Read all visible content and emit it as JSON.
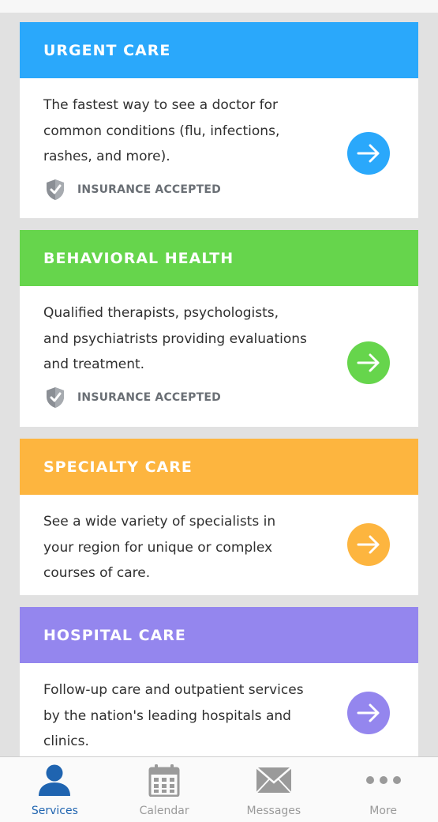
{
  "colors": {
    "urgent": "#2aa8fb",
    "behavioral": "#66d54c",
    "specialty": "#fdb53f",
    "hospital": "#9486ee",
    "active_tab": "#1f64b0",
    "inactive_tab": "#9a9a9a"
  },
  "services": [
    {
      "title": "URGENT CARE",
      "description": "The fastest way to see a doctor for common conditions (flu, infections, rashes, and more).",
      "insurance": "INSURANCE ACCEPTED",
      "icon": "arrow-right-icon"
    },
    {
      "title": "BEHAVIORAL HEALTH",
      "description": "Qualified therapists, psychologists, and psychiatrists providing evaluations and treatment.",
      "insurance": "INSURANCE ACCEPTED",
      "icon": "arrow-right-icon"
    },
    {
      "title": "SPECIALTY CARE",
      "description": "See a wide variety of specialists in your region for unique or complex courses of care.",
      "icon": "arrow-right-icon"
    },
    {
      "title": "HOSPITAL CARE",
      "description": "Follow-up care and outpatient services by the nation's leading hospitals and clinics.",
      "icon": "arrow-right-icon"
    }
  ],
  "tabs": [
    {
      "label": "Services",
      "icon": "person-icon",
      "active": true
    },
    {
      "label": "Calendar",
      "icon": "calendar-icon",
      "active": false
    },
    {
      "label": "Messages",
      "icon": "envelope-icon",
      "active": false
    },
    {
      "label": "More",
      "icon": "more-dots-icon",
      "active": false
    }
  ]
}
